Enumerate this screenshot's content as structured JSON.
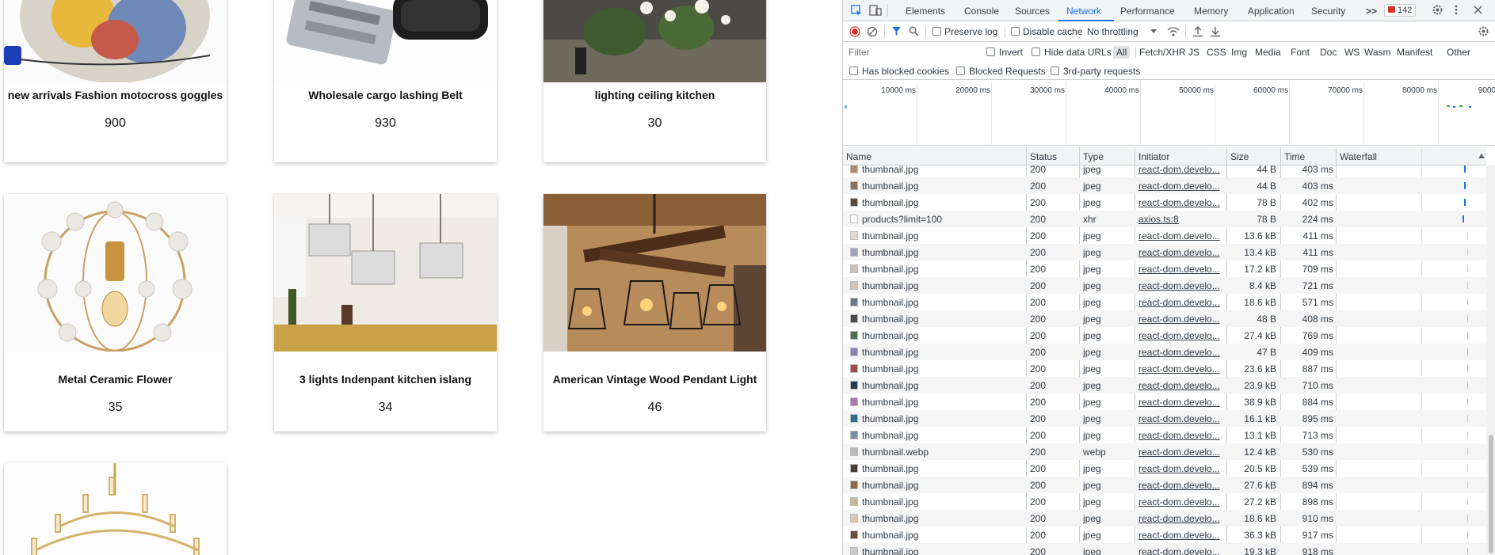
{
  "products": [
    {
      "title": "new arrivals Fashion motocross goggles",
      "price": "900",
      "image": "goggles-photo"
    },
    {
      "title": "Wholesale cargo lashing Belt",
      "price": "930",
      "image": "ratchet-strap-photo"
    },
    {
      "title": "lighting ceiling kitchen",
      "price": "30",
      "image": "ceiling-lights-photo"
    },
    {
      "title": "Metal Ceramic Flower",
      "price": "35",
      "image": "flower-pendant-photo"
    },
    {
      "title": "3 lights Indenpant kitchen islang",
      "price": "34",
      "image": "crystal-pendants-photo"
    },
    {
      "title": "American Vintage Wood Pendant Light",
      "price": "46",
      "image": "wood-chandelier-photo"
    },
    {
      "title": "",
      "price": "",
      "image": "crystal-chandelier-photo"
    }
  ],
  "devtools": {
    "tabs": [
      "Elements",
      "Console",
      "Sources",
      "Network",
      "Performance",
      "Memory",
      "Application",
      "Security"
    ],
    "active_tab": "Network",
    "more_tabs": ">>",
    "issues_count": "142",
    "toolbar": {
      "preserve_log": "Preserve log",
      "disable_cache": "Disable cache",
      "throttling": "No throttling"
    },
    "filter": {
      "placeholder": "Filter",
      "invert": "Invert",
      "hide_data_urls": "Hide data URLs",
      "types": [
        "All",
        "Fetch/XHR",
        "JS",
        "CSS",
        "Img",
        "Media",
        "Font",
        "Doc",
        "WS",
        "Wasm",
        "Manifest",
        "Other"
      ],
      "has_blocked_cookies": "Has blocked cookies",
      "blocked_requests": "Blocked Requests",
      "third_party": "3rd-party requests"
    },
    "overview_ticks": [
      "10000 ms",
      "20000 ms",
      "30000 ms",
      "40000 ms",
      "50000 ms",
      "60000 ms",
      "70000 ms",
      "80000 ms",
      "9000"
    ],
    "columns": [
      "Name",
      "Status",
      "Type",
      "Initiator",
      "Size",
      "Time",
      "Waterfall"
    ],
    "rows": [
      {
        "name": "thumbnail.jpg",
        "status": "200",
        "type": "jpeg",
        "initiator": "react-dom.develo...",
        "size": "44 B",
        "time": "403 ms",
        "icon_color": "#b08a6a"
      },
      {
        "name": "thumbnail.jpg",
        "status": "200",
        "type": "jpeg",
        "initiator": "react-dom.develo...",
        "size": "44 B",
        "time": "403 ms",
        "icon_color": "#8a6f5a"
      },
      {
        "name": "thumbnail.jpg",
        "status": "200",
        "type": "jpeg",
        "initiator": "react-dom.develo...",
        "size": "78 B",
        "time": "402 ms",
        "icon_color": "#5b4a3e"
      },
      {
        "name": "products?limit=100",
        "status": "200",
        "type": "xhr",
        "initiator": "axios.ts:8",
        "size": "78 B",
        "time": "224 ms",
        "icon_color": "#ffffff"
      },
      {
        "name": "thumbnail.jpg",
        "status": "200",
        "type": "jpeg",
        "initiator": "react-dom.develo...",
        "size": "13.6 kB",
        "time": "411 ms",
        "icon_color": "#e8d6d0"
      },
      {
        "name": "thumbnail.jpg",
        "status": "200",
        "type": "jpeg",
        "initiator": "react-dom.develo...",
        "size": "13.4 kB",
        "time": "411 ms",
        "icon_color": "#9aa7b8"
      },
      {
        "name": "thumbnail.jpg",
        "status": "200",
        "type": "jpeg",
        "initiator": "react-dom.develo...",
        "size": "17.2 kB",
        "time": "709 ms",
        "icon_color": "#c9c3b8"
      },
      {
        "name": "thumbnail.jpg",
        "status": "200",
        "type": "jpeg",
        "initiator": "react-dom.develo...",
        "size": "8.4 kB",
        "time": "721 ms",
        "icon_color": "#d3c2b5"
      },
      {
        "name": "thumbnail.jpg",
        "status": "200",
        "type": "jpeg",
        "initiator": "react-dom.develo...",
        "size": "18.6 kB",
        "time": "571 ms",
        "icon_color": "#6e7585"
      },
      {
        "name": "thumbnail.jpg",
        "status": "200",
        "type": "jpeg",
        "initiator": "react-dom.develo...",
        "size": "48 B",
        "time": "408 ms",
        "icon_color": "#4a4a4a"
      },
      {
        "name": "thumbnail.jpg",
        "status": "200",
        "type": "jpeg",
        "initiator": "react-dom.develo...",
        "size": "27.4 kB",
        "time": "769 ms",
        "icon_color": "#556b5a"
      },
      {
        "name": "thumbnail.jpg",
        "status": "200",
        "type": "jpeg",
        "initiator": "react-dom.develo...",
        "size": "47 B",
        "time": "409 ms",
        "icon_color": "#8d7fb6"
      },
      {
        "name": "thumbnail.jpg",
        "status": "200",
        "type": "jpeg",
        "initiator": "react-dom.develo...",
        "size": "23.6 kB",
        "time": "887 ms",
        "icon_color": "#a04a4a"
      },
      {
        "name": "thumbnail.jpg",
        "status": "200",
        "type": "jpeg",
        "initiator": "react-dom.develo...",
        "size": "23.9 kB",
        "time": "710 ms",
        "icon_color": "#2d3a4d"
      },
      {
        "name": "thumbnail.jpg",
        "status": "200",
        "type": "jpeg",
        "initiator": "react-dom.develo...",
        "size": "38.9 kB",
        "time": "884 ms",
        "icon_color": "#b07aa8"
      },
      {
        "name": "thumbnail.jpg",
        "status": "200",
        "type": "jpeg",
        "initiator": "react-dom.develo...",
        "size": "16.1 kB",
        "time": "895 ms",
        "icon_color": "#2f6f8f"
      },
      {
        "name": "thumbnail.jpg",
        "status": "200",
        "type": "jpeg",
        "initiator": "react-dom.develo...",
        "size": "13.1 kB",
        "time": "713 ms",
        "icon_color": "#7a8fa0"
      },
      {
        "name": "thumbnail.webp",
        "status": "200",
        "type": "webp",
        "initiator": "react-dom.develo...",
        "size": "12.4 kB",
        "time": "530 ms",
        "icon_color": "#b8b8b8"
      },
      {
        "name": "thumbnail.jpg",
        "status": "200",
        "type": "jpeg",
        "initiator": "react-dom.develo...",
        "size": "20.5 kB",
        "time": "539 ms",
        "icon_color": "#4d3f35"
      },
      {
        "name": "thumbnail.jpg",
        "status": "200",
        "type": "jpeg",
        "initiator": "react-dom.develo...",
        "size": "27.6 kB",
        "time": "894 ms",
        "icon_color": "#8a6a4a"
      },
      {
        "name": "thumbnail.jpg",
        "status": "200",
        "type": "jpeg",
        "initiator": "react-dom.develo...",
        "size": "27.2 kB",
        "time": "898 ms",
        "icon_color": "#c7b59a"
      },
      {
        "name": "thumbnail.jpg",
        "status": "200",
        "type": "jpeg",
        "initiator": "react-dom.develo...",
        "size": "18.6 kB",
        "time": "910 ms",
        "icon_color": "#d7c7b3"
      },
      {
        "name": "thumbnail.jpg",
        "status": "200",
        "type": "jpeg",
        "initiator": "react-dom.develo...",
        "size": "36.3 kB",
        "time": "917 ms",
        "icon_color": "#6a4a3a"
      },
      {
        "name": "thumbnail.jpg",
        "status": "200",
        "type": "jpeg",
        "initiator": "react-dom.develo...",
        "size": "19.3 kB",
        "time": "918 ms",
        "icon_color": "#c9c9c9"
      }
    ],
    "colors": {
      "accent": "#1a73e8",
      "record": "#d93025",
      "badge": "#d93025"
    }
  }
}
